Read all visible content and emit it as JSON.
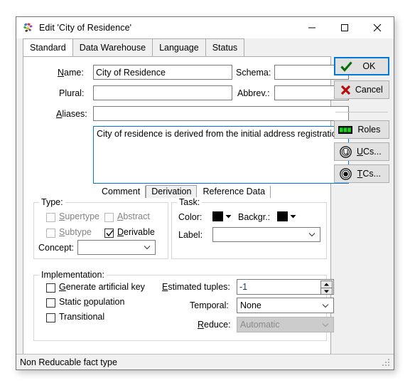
{
  "window": {
    "title": "Edit 'City of Residence'",
    "app_icon": "color-dots-icon",
    "minimize_label": "—",
    "maximize_label": "□",
    "close_label": "✕"
  },
  "tabs": [
    {
      "label": "Standard",
      "active": true
    },
    {
      "label": "Data Warehouse",
      "active": false
    },
    {
      "label": "Language",
      "active": false
    },
    {
      "label": "Status",
      "active": false
    }
  ],
  "form": {
    "name_label": "Name:",
    "name_value": "City of Residence",
    "schema_label": "Schema:",
    "schema_value": "",
    "plural_label": "Plural:",
    "plural_value": "",
    "abbrev_label": "Abbrev.:",
    "abbrev_value": "",
    "aliases_label": "Aliases:",
    "aliases_value": "",
    "comment_value": "City of residence is derived from the initial address registration for a training."
  },
  "comment_tabs": [
    {
      "label": "Comment",
      "active": true
    },
    {
      "label": "Derivation",
      "active": false
    },
    {
      "label": "Reference Data",
      "active": false
    }
  ],
  "type_group": {
    "title": "Type:",
    "supertype_label": "Supertype",
    "supertype_checked": false,
    "supertype_disabled": true,
    "abstract_label": "Abstract",
    "abstract_checked": false,
    "abstract_disabled": true,
    "subtype_label": "Subtype",
    "subtype_checked": false,
    "subtype_disabled": true,
    "derivable_label": "Derivable",
    "derivable_checked": true,
    "derivable_disabled": false,
    "concept_label": "Concept:",
    "concept_value": ""
  },
  "task_group": {
    "title": "Task:",
    "color_label": "Color:",
    "color_value": "#000000",
    "backgr_label": "Backgr.:",
    "backgr_value": "#000000",
    "label_label": "Label:",
    "label_value": ""
  },
  "implementation_group": {
    "title": "Implementation:",
    "generate_key_label": "Generate artificial key",
    "generate_key_checked": false,
    "static_population_label": "Static population",
    "static_population_checked": false,
    "transitional_label": "Transitional",
    "transitional_checked": false,
    "estimated_tuples_label": "Estimated tuples:",
    "estimated_tuples_value": "-1",
    "temporal_label": "Temporal:",
    "temporal_value": "None",
    "reduce_label": "Reduce:",
    "reduce_value": "Automatic",
    "reduce_disabled": true
  },
  "side_buttons": [
    {
      "label": "OK",
      "icon": "green-check-icon",
      "default": true
    },
    {
      "label": "Cancel",
      "icon": "red-x-icon",
      "default": false
    },
    {
      "label": "Roles",
      "icon": "green-bars-icon",
      "default": false
    },
    {
      "label": "UCs...",
      "icon": "u-circle-icon",
      "default": false
    },
    {
      "label": "TCs...",
      "icon": "target-circle-icon",
      "default": false
    }
  ],
  "statusbar": {
    "text": "Non Reducable fact type",
    "grip": "resize-grip-icon"
  },
  "colors": {
    "accent": "#0078d7",
    "dialog_bg": "#f0f0f0",
    "page_bg": "#ffffff",
    "ok_check": "#008000",
    "cancel_x": "#c00000",
    "roles_green": "#00c000",
    "value_text": "#1a3a6b"
  }
}
